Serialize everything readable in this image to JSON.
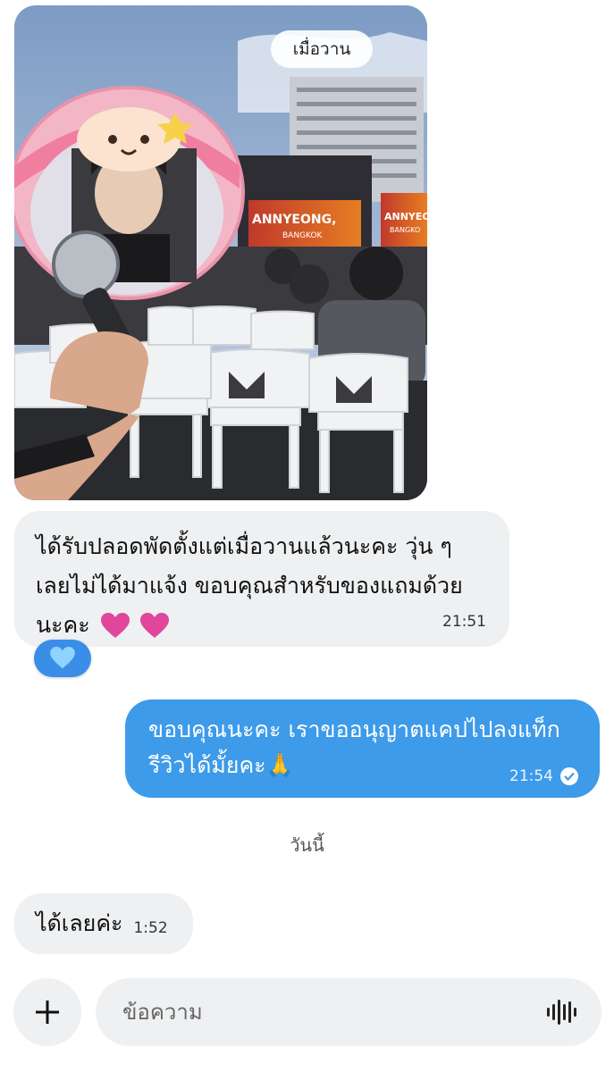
{
  "photo": {
    "date_pill": "เมื่อวาน",
    "screen_text_1": "ANNYEONG,",
    "screen_text_2": "BANGKOK",
    "screen_text_3": "ANNYEON",
    "screen_text_4": "BANGKO"
  },
  "messages": [
    {
      "direction": "incoming",
      "lines": [
        "ได้รับปลอดพัดตั้งแต่เมื่อวานแล้วนะคะ วุ่น ๆ",
        "เลยไม่ได้มาแจ้ง ขอบคุณสำหรับของแถมด้วย",
        "นะคะ"
      ],
      "time": "21:51",
      "reaction": "light-blue-heart"
    },
    {
      "direction": "outgoing",
      "lines": [
        "ขอบคุณนะคะ เราขออนุญาตแคปไปลงแท็ก",
        "รีวิวได้มั้ยคะ🙏"
      ],
      "time": "21:54",
      "status": "read-check"
    },
    {
      "direction": "incoming",
      "lines": [
        "ได้เลยค่ะ"
      ],
      "time": "1:52"
    }
  ],
  "day_divider": "วันนี้",
  "composer": {
    "placeholder": "ข้อความ"
  },
  "colors": {
    "incoming_bubble": "#eef0f2",
    "outgoing_bubble": "#3d9be9",
    "reaction_bg": "#3b8ee8",
    "heart_pink": "#e0469b"
  }
}
